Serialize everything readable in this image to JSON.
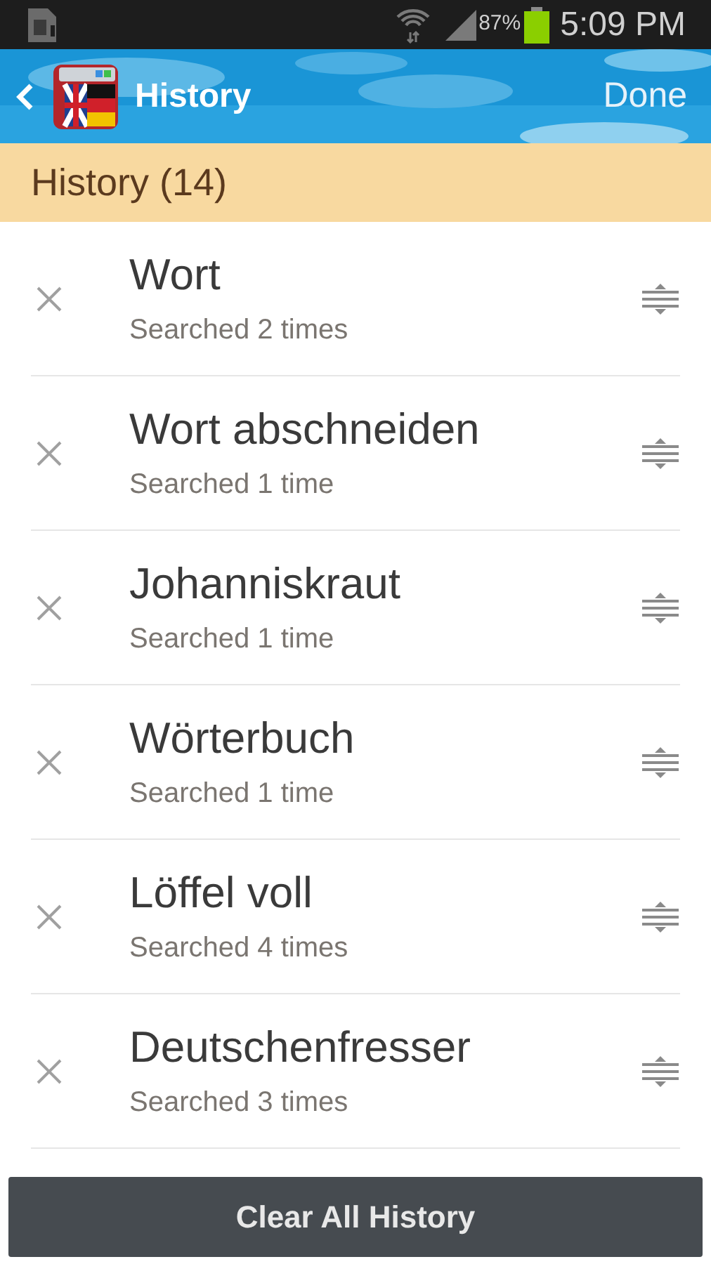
{
  "status_bar": {
    "battery": "87%",
    "time": "5:09 PM"
  },
  "action_bar": {
    "title": "History",
    "done": "Done"
  },
  "section": {
    "title": "History (14)"
  },
  "items": [
    {
      "word": "Wort",
      "count": "Searched 2 times"
    },
    {
      "word": "Wort abschneiden",
      "count": "Searched 1 time"
    },
    {
      "word": "Johanniskraut",
      "count": "Searched 1 time"
    },
    {
      "word": "Wörterbuch",
      "count": "Searched 1 time"
    },
    {
      "word": "Löffel voll",
      "count": "Searched 4 times"
    },
    {
      "word": "Deutschenfresser",
      "count": "Searched 3 times"
    }
  ],
  "clear_button": "Clear All History"
}
